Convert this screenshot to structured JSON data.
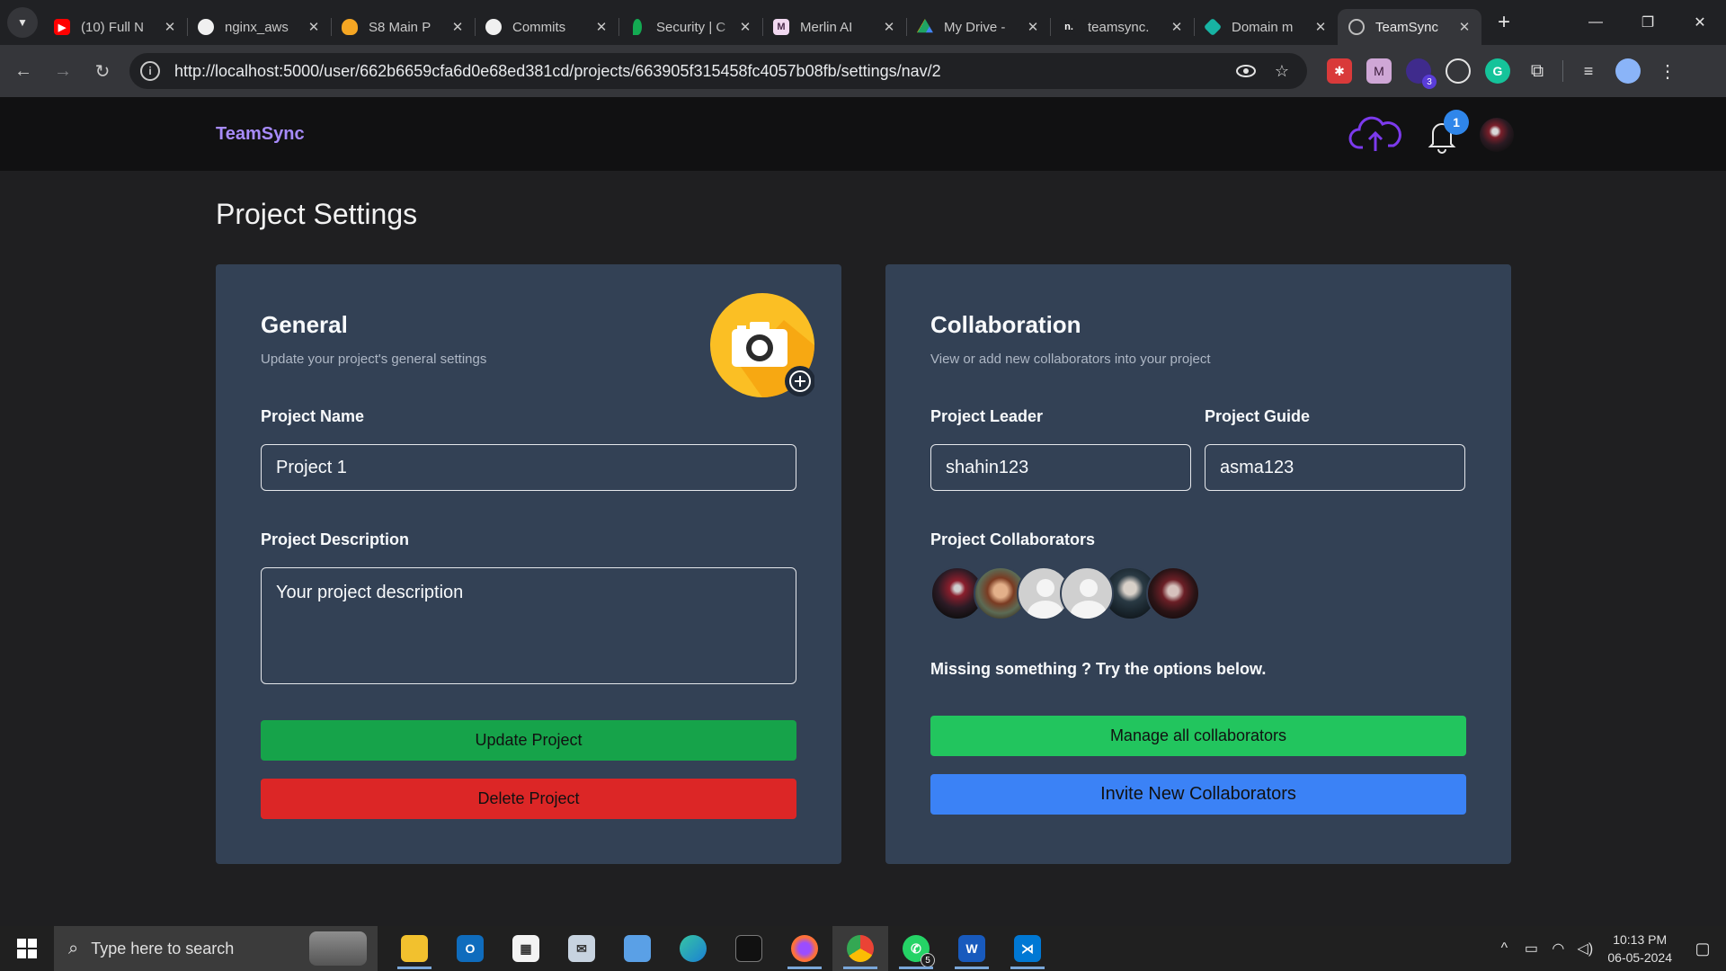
{
  "browser": {
    "tabs": [
      {
        "title": "(10) Full N",
        "fav_color": "#ff0000",
        "fav_glyph": "▶",
        "active": false
      },
      {
        "title": "nginx_aws",
        "fav_color": "#202124",
        "fav_glyph": "",
        "active": false
      },
      {
        "title": "S8 Main P",
        "fav_color": "#f5a623",
        "fav_glyph": "",
        "active": false
      },
      {
        "title": "Commits",
        "fav_color": "#202124",
        "fav_glyph": "",
        "active": false
      },
      {
        "title": "Security | C",
        "fav_color": "#13aa52",
        "fav_glyph": "",
        "active": false
      },
      {
        "title": "Merlin AI",
        "fav_color": "#f1d8f0",
        "fav_glyph": "",
        "active": false
      },
      {
        "title": "My Drive -",
        "fav_color": "#1fa463",
        "fav_glyph": "",
        "active": false
      },
      {
        "title": "teamsync.",
        "fav_color": "#202124",
        "fav_glyph": "n.",
        "active": false
      },
      {
        "title": "Domain m",
        "fav_color": "#17b3a3",
        "fav_glyph": "",
        "active": false
      },
      {
        "title": "TeamSync",
        "fav_color": "#5f6368",
        "fav_glyph": "",
        "active": true
      }
    ],
    "url": "http://localhost:5000/user/662b6659cfa6d0e68ed381cd/projects/663905f315458fc4057b08fb/settings/nav/2",
    "extension_badge": "3"
  },
  "app": {
    "brand": "TeamSync",
    "notification_count": "1",
    "page_title": "Project Settings"
  },
  "general": {
    "heading": "General",
    "subtitle": "Update your project's general settings",
    "name_label": "Project Name",
    "name_value": "Project 1",
    "desc_label": "Project Description",
    "desc_placeholder": "Your project description",
    "update_label": "Update Project",
    "delete_label": "Delete Project"
  },
  "collaboration": {
    "heading": "Collaboration",
    "subtitle": "View or add new collaborators into your project",
    "leader_label": "Project Leader",
    "leader_value": "shahin123",
    "guide_label": "Project Guide",
    "guide_value": "asma123",
    "collaborators_label": "Project Collaborators",
    "collaborator_count": 6,
    "missing_text": "Missing something ? Try the options below.",
    "manage_label": "Manage all collaborators",
    "invite_label": "Invite New Collaborators"
  },
  "taskbar": {
    "search_placeholder": "Type here to search",
    "whatsapp_badge": "5",
    "time": "10:13 PM",
    "date": "06-05-2024"
  },
  "colors": {
    "brand": "#a78bfa",
    "card": "#334155",
    "update": "#16a34a",
    "delete": "#dc2626",
    "manage": "#22c55e",
    "invite": "#3b82f6",
    "badge": "#2f86ea"
  }
}
